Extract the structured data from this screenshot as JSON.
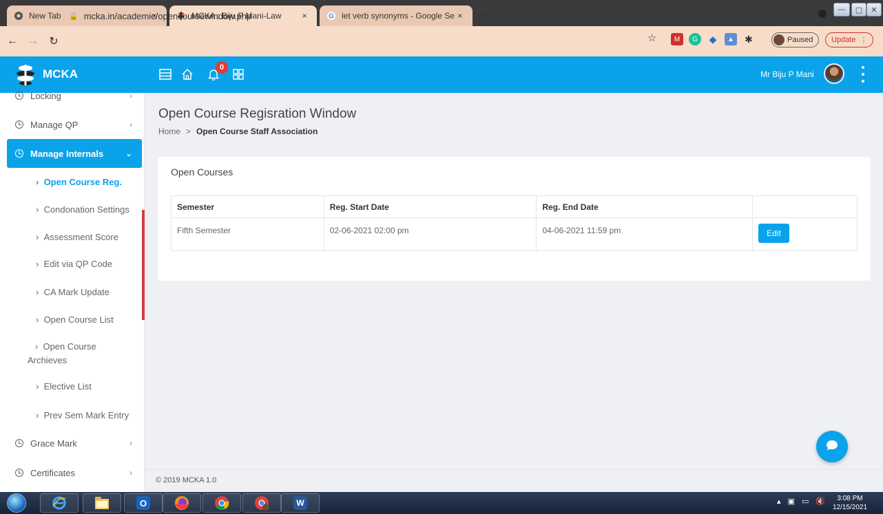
{
  "browser": {
    "tabs": [
      {
        "label": "New Tab",
        "active": false,
        "icon": "chrome-newtab-icon"
      },
      {
        "label": "MCKA : Biju P Mani-Law",
        "active": true,
        "icon": "mcka-favicon"
      },
      {
        "label": "let verb synonyms - Google Search",
        "active": false,
        "icon": "google-icon"
      }
    ],
    "new_tab_glyph": "+",
    "tab_close_glyph": "×",
    "url": "mcka.in/academic/opencoursewindow.php",
    "paused_label": "Paused",
    "update_label": "Update"
  },
  "header": {
    "app_name": "MCKA",
    "notification_count": "0",
    "user_name": "Mr Biju P Mani",
    "accent_color": "#0aa3ea"
  },
  "sidebar": {
    "items": [
      {
        "label": "Locking"
      },
      {
        "label": "Manage QP"
      },
      {
        "label": "Manage Internals"
      },
      {
        "label": "Grace Mark"
      },
      {
        "label": "Certificates"
      }
    ],
    "sub_items": [
      "Open Course Reg.",
      "Condonation Settings",
      "Assessment Score",
      "Edit via QP Code",
      "CA Mark Update",
      "Open Course List",
      "Open Course Archieves",
      "Elective List",
      "Prev Sem Mark Entry"
    ]
  },
  "page": {
    "title": "Open Course Regisration Window",
    "breadcrumb": {
      "home": "Home",
      "separator": ">",
      "current": "Open Course Staff Association"
    }
  },
  "card": {
    "title": "Open Courses",
    "columns": [
      "Semester",
      "Reg. Start Date",
      "Reg. End Date",
      ""
    ],
    "rows": [
      {
        "semester": "Fifth Semester",
        "start": "02-06-2021 02:00 pm",
        "end": "04-06-2021 11:59 pm",
        "action": "Edit"
      }
    ]
  },
  "footer": {
    "text": "© 2019 MCKA 1.0"
  },
  "taskbar": {
    "time": "3:08 PM",
    "date": "12/15/2021"
  }
}
